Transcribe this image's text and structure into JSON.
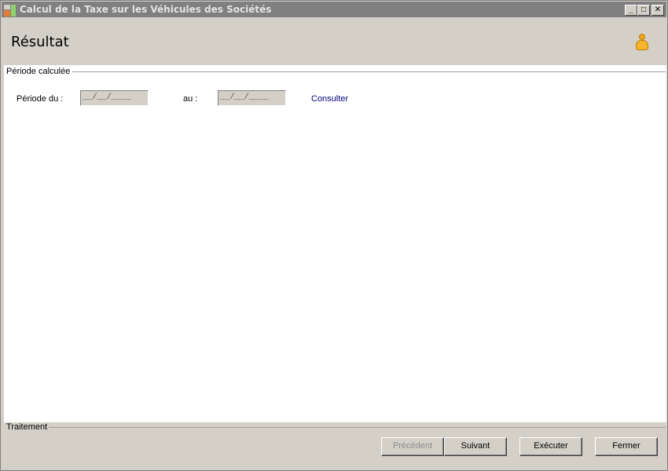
{
  "window": {
    "title": "Calcul de la Taxe sur les Véhicules des Sociétés",
    "min_symbol": "_",
    "max_symbol": "□",
    "close_symbol": "✕"
  },
  "header": {
    "title": "Résultat",
    "user_icon": "user-icon"
  },
  "periode": {
    "group_label": "Période calculée",
    "from_label": "Période du :",
    "from_value": "__/__/____",
    "to_label": "au :",
    "to_value": "__/__/____",
    "consult_link": "Consulter"
  },
  "footer": {
    "group_label": "Traitement",
    "buttons": {
      "previous": "Précédent",
      "next": "Suivant",
      "execute": "Exécuter",
      "close": "Fermer"
    }
  }
}
